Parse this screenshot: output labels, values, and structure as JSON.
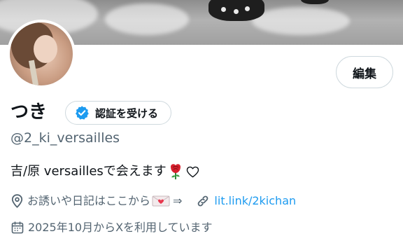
{
  "profile": {
    "display_name": "つき",
    "verify_label": "認証を受ける",
    "handle": "@2_ki_versailles",
    "edit_label": "編集",
    "bio": {
      "text": "吉/原 versaillesで会えます"
    },
    "location": {
      "text": "お誘いや日記はここから",
      "arrow": "⇒"
    },
    "link": {
      "text": "lit.link/2kichan"
    },
    "joined": {
      "text": "2025年10月からXを利用しています"
    }
  },
  "icons": {
    "verify": "verified-badge-icon",
    "location": "map-pin-icon",
    "love_letter": "love-letter-icon",
    "rose": "rose-icon",
    "heart": "white-heart-icon",
    "link": "link-icon",
    "calendar": "calendar-icon"
  },
  "colors": {
    "accent": "#1d9bf0",
    "text": "#0f1419",
    "secondary_text": "#536471",
    "border": "#cfd9de",
    "verified_blue": "#1d9bf0"
  }
}
